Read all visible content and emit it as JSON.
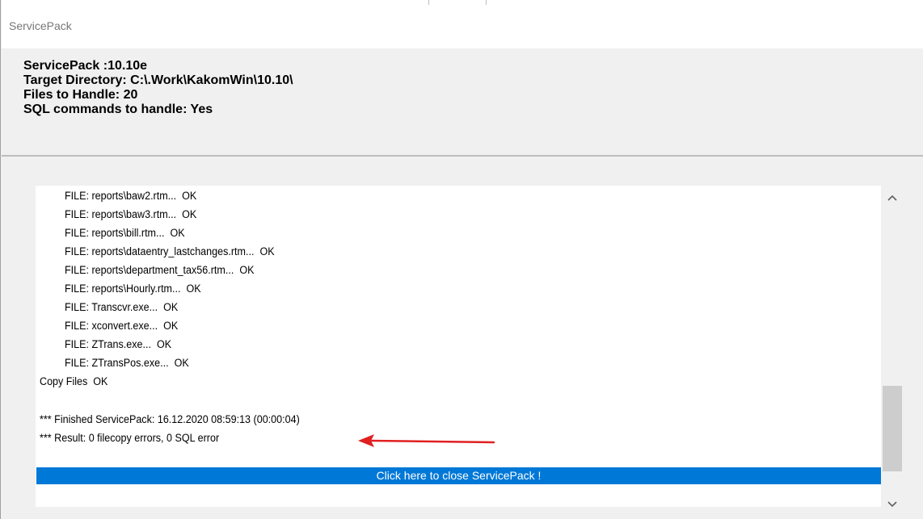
{
  "window": {
    "title": "ServicePack"
  },
  "info": {
    "line1": "ServicePack :10.10e",
    "line2": "Target Directory: C:\\.Work\\KakomWin\\10.10\\",
    "line3": "Files to Handle: 20",
    "line4": "SQL commands to handle: Yes"
  },
  "log": {
    "lines": [
      "FILE: reports\\baw2.rtm...  OK",
      "FILE: reports\\baw3.rtm...  OK",
      "FILE: reports\\bill.rtm...  OK",
      "FILE: reports\\dataentry_lastchanges.rtm...  OK",
      "FILE: reports\\department_tax56.rtm...  OK",
      "FILE: reports\\Hourly.rtm...  OK",
      "FILE: Transcvr.exe...  OK",
      "FILE: xconvert.exe...  OK",
      "FILE: ZTrans.exe...  OK",
      "FILE: ZTransPos.exe...  OK",
      "Copy Files  OK",
      "*** Finished ServicePack: 16.12.2020 08:59:13 (00:00:04)",
      "*** Result: 0 filecopy errors, 0 SQL error"
    ]
  },
  "close_bar": {
    "label": "Click here to close ServicePack !"
  },
  "colors": {
    "accent": "#0078d7",
    "annotation_arrow": "#e02020"
  },
  "icons": {
    "scroll_up": "chevron-up-icon",
    "scroll_down": "chevron-down-icon",
    "annotation": "red-arrow-icon"
  }
}
